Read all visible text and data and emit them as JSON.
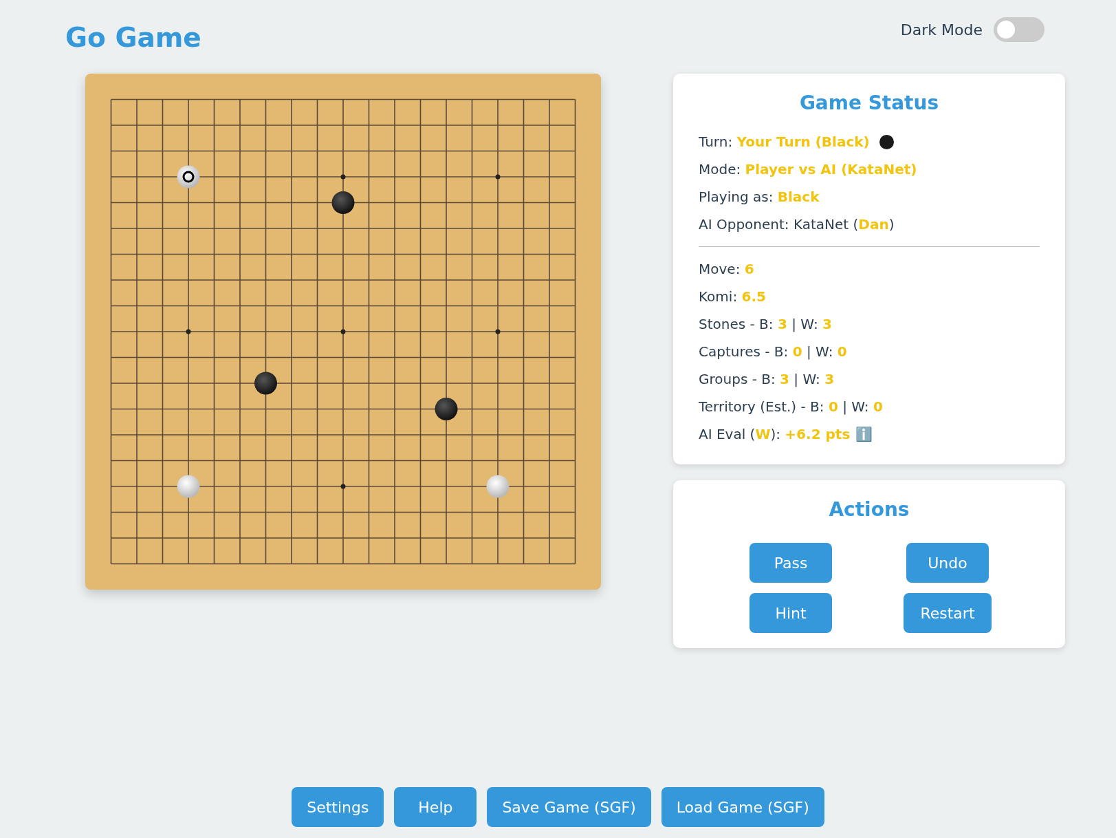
{
  "title": "Go Game",
  "dark_mode": {
    "label": "Dark Mode",
    "on": false
  },
  "board": [
    [
      {
        "kind": "empty"
      },
      {
        "kind": "empty"
      },
      {
        "kind": "empty"
      },
      {
        "kind": "empty"
      },
      {
        "kind": "empty"
      },
      {
        "kind": "empty"
      },
      {
        "kind": "empty"
      },
      {
        "kind": "empty"
      },
      {
        "kind": "empty"
      },
      {
        "kind": "empty"
      },
      {
        "kind": "empty"
      },
      {
        "kind": "empty"
      },
      {
        "kind": "empty"
      },
      {
        "kind": "empty"
      },
      {
        "kind": "empty"
      },
      {
        "kind": "empty"
      },
      {
        "kind": "empty"
      },
      {
        "kind": "empty"
      },
      {
        "kind": "empty"
      }
    ],
    [
      {
        "kind": "empty"
      },
      {
        "kind": "empty"
      },
      {
        "kind": "empty"
      },
      {
        "kind": "empty"
      },
      {
        "kind": "empty"
      },
      {
        "kind": "empty"
      },
      {
        "kind": "empty"
      },
      {
        "kind": "empty"
      },
      {
        "kind": "empty"
      },
      {
        "kind": "empty"
      },
      {
        "kind": "empty"
      },
      {
        "kind": "empty"
      },
      {
        "kind": "empty"
      },
      {
        "kind": "empty"
      },
      {
        "kind": "empty"
      },
      {
        "kind": "empty"
      },
      {
        "kind": "empty"
      },
      {
        "kind": "empty"
      },
      {
        "kind": "empty"
      }
    ],
    [
      {
        "kind": "empty"
      },
      {
        "kind": "empty"
      },
      {
        "kind": "empty"
      },
      {
        "kind": "empty"
      },
      {
        "kind": "empty"
      },
      {
        "kind": "empty"
      },
      {
        "kind": "empty"
      },
      {
        "kind": "empty"
      },
      {
        "kind": "empty"
      },
      {
        "kind": "empty"
      },
      {
        "kind": "empty"
      },
      {
        "kind": "empty"
      },
      {
        "kind": "empty"
      },
      {
        "kind": "empty"
      },
      {
        "kind": "empty"
      },
      {
        "kind": "empty"
      },
      {
        "kind": "empty"
      },
      {
        "kind": "empty"
      },
      {
        "kind": "empty"
      }
    ],
    [
      {
        "kind": "empty"
      },
      {
        "kind": "empty"
      },
      {
        "kind": "empty"
      },
      {
        "kind": "white",
        "last_move": true
      },
      {
        "kind": "empty"
      },
      {
        "kind": "empty"
      },
      {
        "kind": "empty"
      },
      {
        "kind": "empty"
      },
      {
        "kind": "empty"
      },
      {
        "kind": "empty"
      },
      {
        "kind": "empty"
      },
      {
        "kind": "empty"
      },
      {
        "kind": "empty"
      },
      {
        "kind": "empty"
      },
      {
        "kind": "empty"
      },
      {
        "kind": "empty"
      },
      {
        "kind": "empty"
      },
      {
        "kind": "empty"
      },
      {
        "kind": "empty"
      }
    ],
    [
      {
        "kind": "empty"
      },
      {
        "kind": "empty"
      },
      {
        "kind": "empty"
      },
      {
        "kind": "empty"
      },
      {
        "kind": "empty"
      },
      {
        "kind": "empty"
      },
      {
        "kind": "empty"
      },
      {
        "kind": "empty"
      },
      {
        "kind": "empty"
      },
      {
        "kind": "black",
        "last_move": false
      },
      {
        "kind": "empty"
      },
      {
        "kind": "empty"
      },
      {
        "kind": "empty"
      },
      {
        "kind": "empty"
      },
      {
        "kind": "empty"
      },
      {
        "kind": "empty"
      },
      {
        "kind": "empty"
      },
      {
        "kind": "empty"
      },
      {
        "kind": "empty"
      }
    ],
    [
      {
        "kind": "empty"
      },
      {
        "kind": "empty"
      },
      {
        "kind": "empty"
      },
      {
        "kind": "empty"
      },
      {
        "kind": "empty"
      },
      {
        "kind": "empty"
      },
      {
        "kind": "empty"
      },
      {
        "kind": "empty"
      },
      {
        "kind": "empty"
      },
      {
        "kind": "empty"
      },
      {
        "kind": "empty"
      },
      {
        "kind": "empty"
      },
      {
        "kind": "empty"
      },
      {
        "kind": "empty"
      },
      {
        "kind": "empty"
      },
      {
        "kind": "empty"
      },
      {
        "kind": "empty"
      },
      {
        "kind": "empty"
      },
      {
        "kind": "empty"
      }
    ],
    [
      {
        "kind": "empty"
      },
      {
        "kind": "empty"
      },
      {
        "kind": "empty"
      },
      {
        "kind": "empty"
      },
      {
        "kind": "empty"
      },
      {
        "kind": "empty"
      },
      {
        "kind": "empty"
      },
      {
        "kind": "empty"
      },
      {
        "kind": "empty"
      },
      {
        "kind": "empty"
      },
      {
        "kind": "empty"
      },
      {
        "kind": "empty"
      },
      {
        "kind": "empty"
      },
      {
        "kind": "empty"
      },
      {
        "kind": "empty"
      },
      {
        "kind": "empty"
      },
      {
        "kind": "empty"
      },
      {
        "kind": "empty"
      },
      {
        "kind": "empty"
      }
    ],
    [
      {
        "kind": "empty"
      },
      {
        "kind": "empty"
      },
      {
        "kind": "empty"
      },
      {
        "kind": "empty"
      },
      {
        "kind": "empty"
      },
      {
        "kind": "empty"
      },
      {
        "kind": "empty"
      },
      {
        "kind": "empty"
      },
      {
        "kind": "empty"
      },
      {
        "kind": "empty"
      },
      {
        "kind": "empty"
      },
      {
        "kind": "empty"
      },
      {
        "kind": "empty"
      },
      {
        "kind": "empty"
      },
      {
        "kind": "empty"
      },
      {
        "kind": "empty"
      },
      {
        "kind": "empty"
      },
      {
        "kind": "empty"
      },
      {
        "kind": "empty"
      }
    ],
    [
      {
        "kind": "empty"
      },
      {
        "kind": "empty"
      },
      {
        "kind": "empty"
      },
      {
        "kind": "empty"
      },
      {
        "kind": "empty"
      },
      {
        "kind": "empty"
      },
      {
        "kind": "empty"
      },
      {
        "kind": "empty"
      },
      {
        "kind": "empty"
      },
      {
        "kind": "empty"
      },
      {
        "kind": "empty"
      },
      {
        "kind": "empty"
      },
      {
        "kind": "empty"
      },
      {
        "kind": "empty"
      },
      {
        "kind": "empty"
      },
      {
        "kind": "empty"
      },
      {
        "kind": "empty"
      },
      {
        "kind": "empty"
      },
      {
        "kind": "empty"
      }
    ],
    [
      {
        "kind": "empty"
      },
      {
        "kind": "empty"
      },
      {
        "kind": "empty"
      },
      {
        "kind": "empty"
      },
      {
        "kind": "empty"
      },
      {
        "kind": "empty"
      },
      {
        "kind": "empty"
      },
      {
        "kind": "empty"
      },
      {
        "kind": "empty"
      },
      {
        "kind": "empty"
      },
      {
        "kind": "empty"
      },
      {
        "kind": "empty"
      },
      {
        "kind": "empty"
      },
      {
        "kind": "empty"
      },
      {
        "kind": "empty"
      },
      {
        "kind": "empty"
      },
      {
        "kind": "empty"
      },
      {
        "kind": "empty"
      },
      {
        "kind": "empty"
      }
    ],
    [
      {
        "kind": "empty"
      },
      {
        "kind": "empty"
      },
      {
        "kind": "empty"
      },
      {
        "kind": "empty"
      },
      {
        "kind": "empty"
      },
      {
        "kind": "empty"
      },
      {
        "kind": "empty"
      },
      {
        "kind": "empty"
      },
      {
        "kind": "empty"
      },
      {
        "kind": "empty"
      },
      {
        "kind": "empty"
      },
      {
        "kind": "empty"
      },
      {
        "kind": "empty"
      },
      {
        "kind": "empty"
      },
      {
        "kind": "empty"
      },
      {
        "kind": "empty"
      },
      {
        "kind": "empty"
      },
      {
        "kind": "empty"
      },
      {
        "kind": "empty"
      }
    ],
    [
      {
        "kind": "empty"
      },
      {
        "kind": "empty"
      },
      {
        "kind": "empty"
      },
      {
        "kind": "empty"
      },
      {
        "kind": "empty"
      },
      {
        "kind": "empty"
      },
      {
        "kind": "black",
        "last_move": false
      },
      {
        "kind": "empty"
      },
      {
        "kind": "empty"
      },
      {
        "kind": "empty"
      },
      {
        "kind": "empty"
      },
      {
        "kind": "empty"
      },
      {
        "kind": "empty"
      },
      {
        "kind": "empty"
      },
      {
        "kind": "empty"
      },
      {
        "kind": "empty"
      },
      {
        "kind": "empty"
      },
      {
        "kind": "empty"
      },
      {
        "kind": "empty"
      }
    ],
    [
      {
        "kind": "empty"
      },
      {
        "kind": "empty"
      },
      {
        "kind": "empty"
      },
      {
        "kind": "empty"
      },
      {
        "kind": "empty"
      },
      {
        "kind": "empty"
      },
      {
        "kind": "empty"
      },
      {
        "kind": "empty"
      },
      {
        "kind": "empty"
      },
      {
        "kind": "empty"
      },
      {
        "kind": "empty"
      },
      {
        "kind": "empty"
      },
      {
        "kind": "empty"
      },
      {
        "kind": "black",
        "last_move": false
      },
      {
        "kind": "empty"
      },
      {
        "kind": "empty"
      },
      {
        "kind": "empty"
      },
      {
        "kind": "empty"
      },
      {
        "kind": "empty"
      }
    ],
    [
      {
        "kind": "empty"
      },
      {
        "kind": "empty"
      },
      {
        "kind": "empty"
      },
      {
        "kind": "empty"
      },
      {
        "kind": "empty"
      },
      {
        "kind": "empty"
      },
      {
        "kind": "empty"
      },
      {
        "kind": "empty"
      },
      {
        "kind": "empty"
      },
      {
        "kind": "empty"
      },
      {
        "kind": "empty"
      },
      {
        "kind": "empty"
      },
      {
        "kind": "empty"
      },
      {
        "kind": "empty"
      },
      {
        "kind": "empty"
      },
      {
        "kind": "empty"
      },
      {
        "kind": "empty"
      },
      {
        "kind": "empty"
      },
      {
        "kind": "empty"
      }
    ],
    [
      {
        "kind": "empty"
      },
      {
        "kind": "empty"
      },
      {
        "kind": "empty"
      },
      {
        "kind": "empty"
      },
      {
        "kind": "empty"
      },
      {
        "kind": "empty"
      },
      {
        "kind": "empty"
      },
      {
        "kind": "empty"
      },
      {
        "kind": "empty"
      },
      {
        "kind": "empty"
      },
      {
        "kind": "empty"
      },
      {
        "kind": "empty"
      },
      {
        "kind": "empty"
      },
      {
        "kind": "empty"
      },
      {
        "kind": "empty"
      },
      {
        "kind": "empty"
      },
      {
        "kind": "empty"
      },
      {
        "kind": "empty"
      },
      {
        "kind": "empty"
      }
    ],
    [
      {
        "kind": "empty"
      },
      {
        "kind": "empty"
      },
      {
        "kind": "empty"
      },
      {
        "kind": "white",
        "last_move": false
      },
      {
        "kind": "empty"
      },
      {
        "kind": "empty"
      },
      {
        "kind": "empty"
      },
      {
        "kind": "empty"
      },
      {
        "kind": "empty"
      },
      {
        "kind": "empty"
      },
      {
        "kind": "empty"
      },
      {
        "kind": "empty"
      },
      {
        "kind": "empty"
      },
      {
        "kind": "empty"
      },
      {
        "kind": "empty"
      },
      {
        "kind": "white",
        "last_move": false
      },
      {
        "kind": "empty"
      },
      {
        "kind": "empty"
      },
      {
        "kind": "empty"
      }
    ],
    [
      {
        "kind": "empty"
      },
      {
        "kind": "empty"
      },
      {
        "kind": "empty"
      },
      {
        "kind": "empty"
      },
      {
        "kind": "empty"
      },
      {
        "kind": "empty"
      },
      {
        "kind": "empty"
      },
      {
        "kind": "empty"
      },
      {
        "kind": "empty"
      },
      {
        "kind": "empty"
      },
      {
        "kind": "empty"
      },
      {
        "kind": "empty"
      },
      {
        "kind": "empty"
      },
      {
        "kind": "empty"
      },
      {
        "kind": "empty"
      },
      {
        "kind": "empty"
      },
      {
        "kind": "empty"
      },
      {
        "kind": "empty"
      },
      {
        "kind": "empty"
      }
    ],
    [
      {
        "kind": "empty"
      },
      {
        "kind": "empty"
      },
      {
        "kind": "empty"
      },
      {
        "kind": "empty"
      },
      {
        "kind": "empty"
      },
      {
        "kind": "empty"
      },
      {
        "kind": "empty"
      },
      {
        "kind": "empty"
      },
      {
        "kind": "empty"
      },
      {
        "kind": "empty"
      },
      {
        "kind": "empty"
      },
      {
        "kind": "empty"
      },
      {
        "kind": "empty"
      },
      {
        "kind": "empty"
      },
      {
        "kind": "empty"
      },
      {
        "kind": "empty"
      },
      {
        "kind": "empty"
      },
      {
        "kind": "empty"
      },
      {
        "kind": "empty"
      }
    ],
    [
      {
        "kind": "empty"
      },
      {
        "kind": "empty"
      },
      {
        "kind": "empty"
      },
      {
        "kind": "empty"
      },
      {
        "kind": "empty"
      },
      {
        "kind": "empty"
      },
      {
        "kind": "empty"
      },
      {
        "kind": "empty"
      },
      {
        "kind": "empty"
      },
      {
        "kind": "empty"
      },
      {
        "kind": "empty"
      },
      {
        "kind": "empty"
      },
      {
        "kind": "empty"
      },
      {
        "kind": "empty"
      },
      {
        "kind": "empty"
      },
      {
        "kind": "empty"
      },
      {
        "kind": "empty"
      },
      {
        "kind": "empty"
      },
      {
        "kind": "empty"
      }
    ]
  ],
  "status": {
    "title": "Game Status",
    "turn": {
      "text": "Turn: **Your Turn (Black)**",
      "color": "#1a1a1a"
    },
    "player_lines": [
      "Mode: **Player vs AI (KataNet)**",
      "Playing as: **Black**",
      "AI Opponent: KataNet (**Dan**)"
    ],
    "game_lines": [
      "Move: **6**",
      "Komi: **6.5**",
      "Stones - B: **3** | W: **3**",
      "Captures - B: **0** | W: **0**",
      "Groups - B: **3** | W: **3**",
      "Territory (Est.) - B: **0** | W: **0**"
    ],
    "eval": {
      "text": "AI Eval (**W**): **+6.2 pts**",
      "info": "ℹ️"
    }
  },
  "actions": {
    "title": "Actions",
    "buttons": [
      "Pass",
      "Undo",
      "Hint",
      "Restart"
    ]
  },
  "footer_buttons": [
    "Settings",
    "Help",
    "Save Game (SGF)",
    "Load Game (SGF)"
  ]
}
